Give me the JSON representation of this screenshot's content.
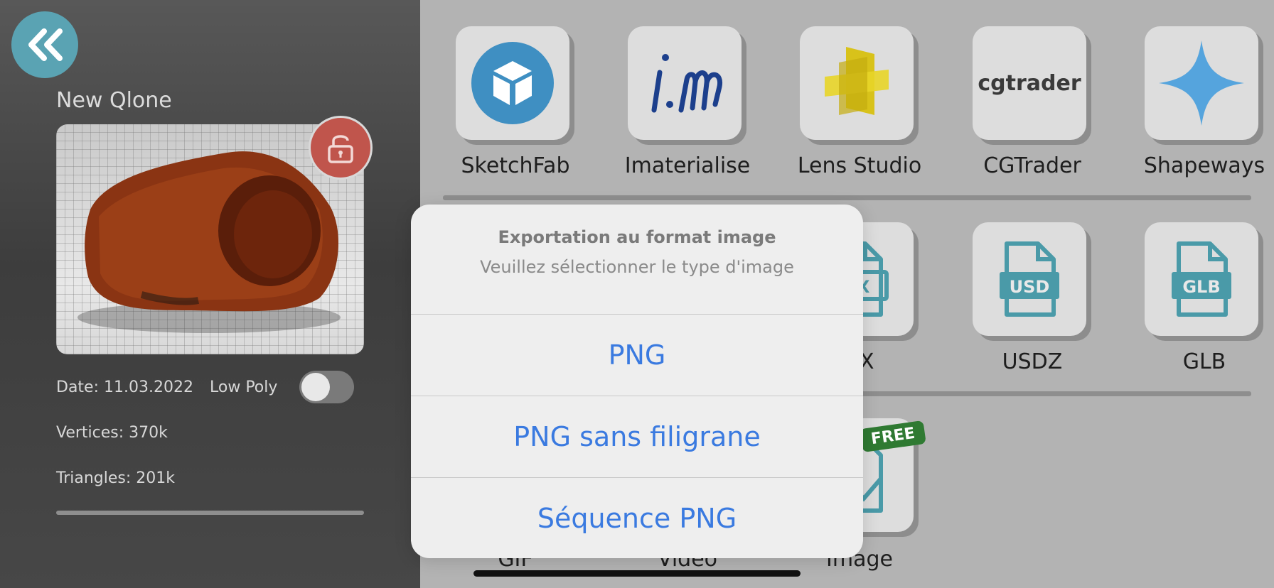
{
  "left_panel": {
    "project_name": "New Qlone",
    "date": "Date: 11.03.2022",
    "low_poly_label": "Low Poly",
    "low_poly_enabled": false,
    "vertices": "Vertices: 370k",
    "triangles": "Triangles: 201k"
  },
  "export_services": [
    {
      "label": "SketchFab",
      "icon": "sketchfab-cube-icon"
    },
    {
      "label": "Imaterialise",
      "icon": "imaterialise-logo-icon"
    },
    {
      "label": "Lens Studio",
      "icon": "lens-studio-logo-icon"
    },
    {
      "label": "CGTrader",
      "icon": "cgtrader-logo-icon",
      "logo_text": "cgtrader"
    },
    {
      "label": "Shapeways",
      "icon": "shapeways-star-icon"
    }
  ],
  "file_formats": [
    {
      "label": "BX",
      "icon": "file-fbx-icon",
      "badge": "BX"
    },
    {
      "label": "USDZ",
      "icon": "file-usd-icon",
      "badge": "USD"
    },
    {
      "label": "GLB",
      "icon": "file-glb-icon",
      "badge": "GLB"
    }
  ],
  "media": [
    {
      "label": "GIF"
    },
    {
      "label": "Video"
    },
    {
      "label": "Image",
      "badge": "FREE"
    }
  ],
  "action_sheet": {
    "title": "Exportation au format image",
    "message": "Veuillez sélectionner le type d'image",
    "options": [
      "PNG",
      "PNG sans filigrane",
      "Séquence PNG"
    ]
  },
  "colors": {
    "accent_teal": "#5aa3b3",
    "lock_red": "#c0554c",
    "ios_blue": "#3a7ae0",
    "file_icon_teal": "#4a9aa8"
  }
}
